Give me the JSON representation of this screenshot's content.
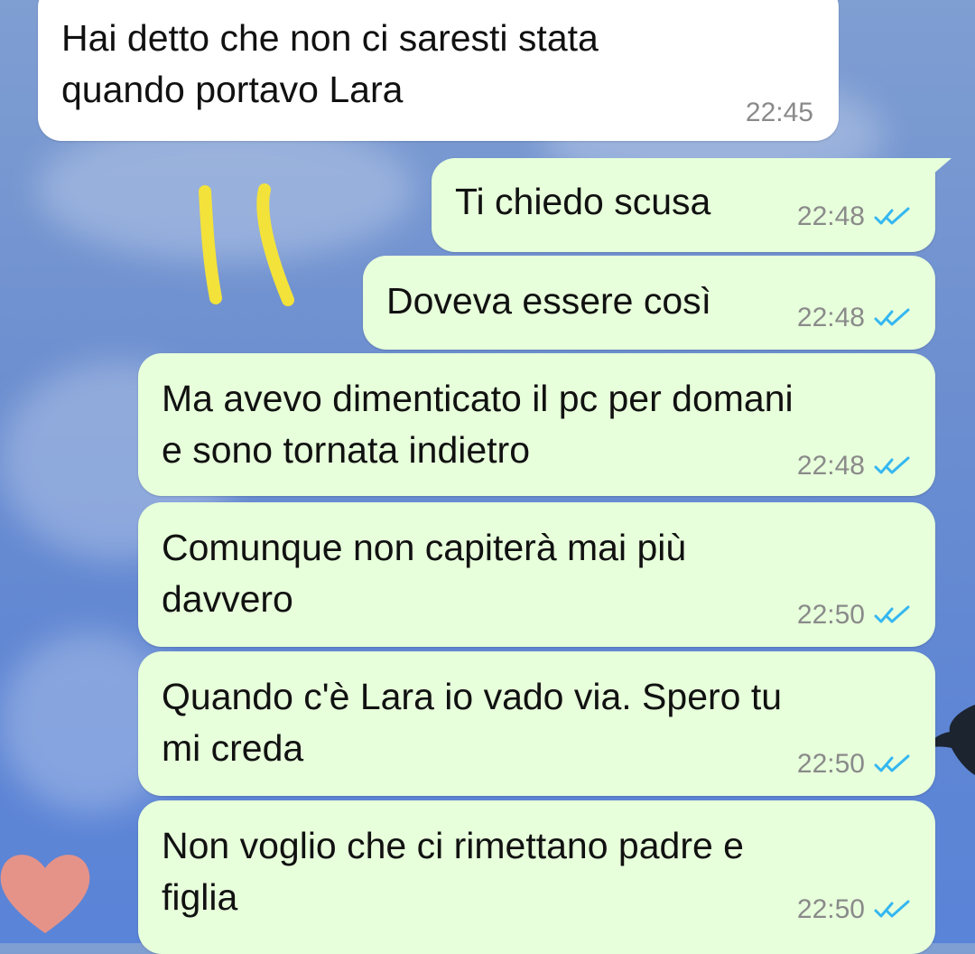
{
  "chat": {
    "messages": [
      {
        "direction": "incoming",
        "text": "Hai detto che non ci saresti stata\nquando portavo Lara",
        "time": "22:45"
      },
      {
        "direction": "outgoing",
        "text": "Ti chiedo scusa",
        "time": "22:48",
        "status": "read-double-check-icon"
      },
      {
        "direction": "outgoing",
        "text": "Doveva essere così",
        "time": "22:48",
        "status": "read-double-check-icon"
      },
      {
        "direction": "outgoing",
        "text": "Ma avevo dimenticato il pc per domani\ne sono tornata indietro",
        "time": "22:48",
        "status": "read-double-check-icon"
      },
      {
        "direction": "outgoing",
        "text": "Comunque non capiterà mai più\ndavvero",
        "time": "22:50",
        "status": "read-double-check-icon"
      },
      {
        "direction": "outgoing",
        "text": "Quando c'è Lara io vado via. Spero tu\nmi creda",
        "time": "22:50",
        "status": "read-double-check-icon"
      },
      {
        "direction": "outgoing",
        "text": "Non voglio che ci rimettano padre e\nfiglia",
        "time": "22:50",
        "status": "read-double-check-icon"
      }
    ]
  },
  "colors": {
    "incoming_bubble": "#ffffff",
    "outgoing_bubble": "#e7ffdb",
    "read_ticks": "#34b7f1",
    "doodle": "#f3e23a"
  }
}
